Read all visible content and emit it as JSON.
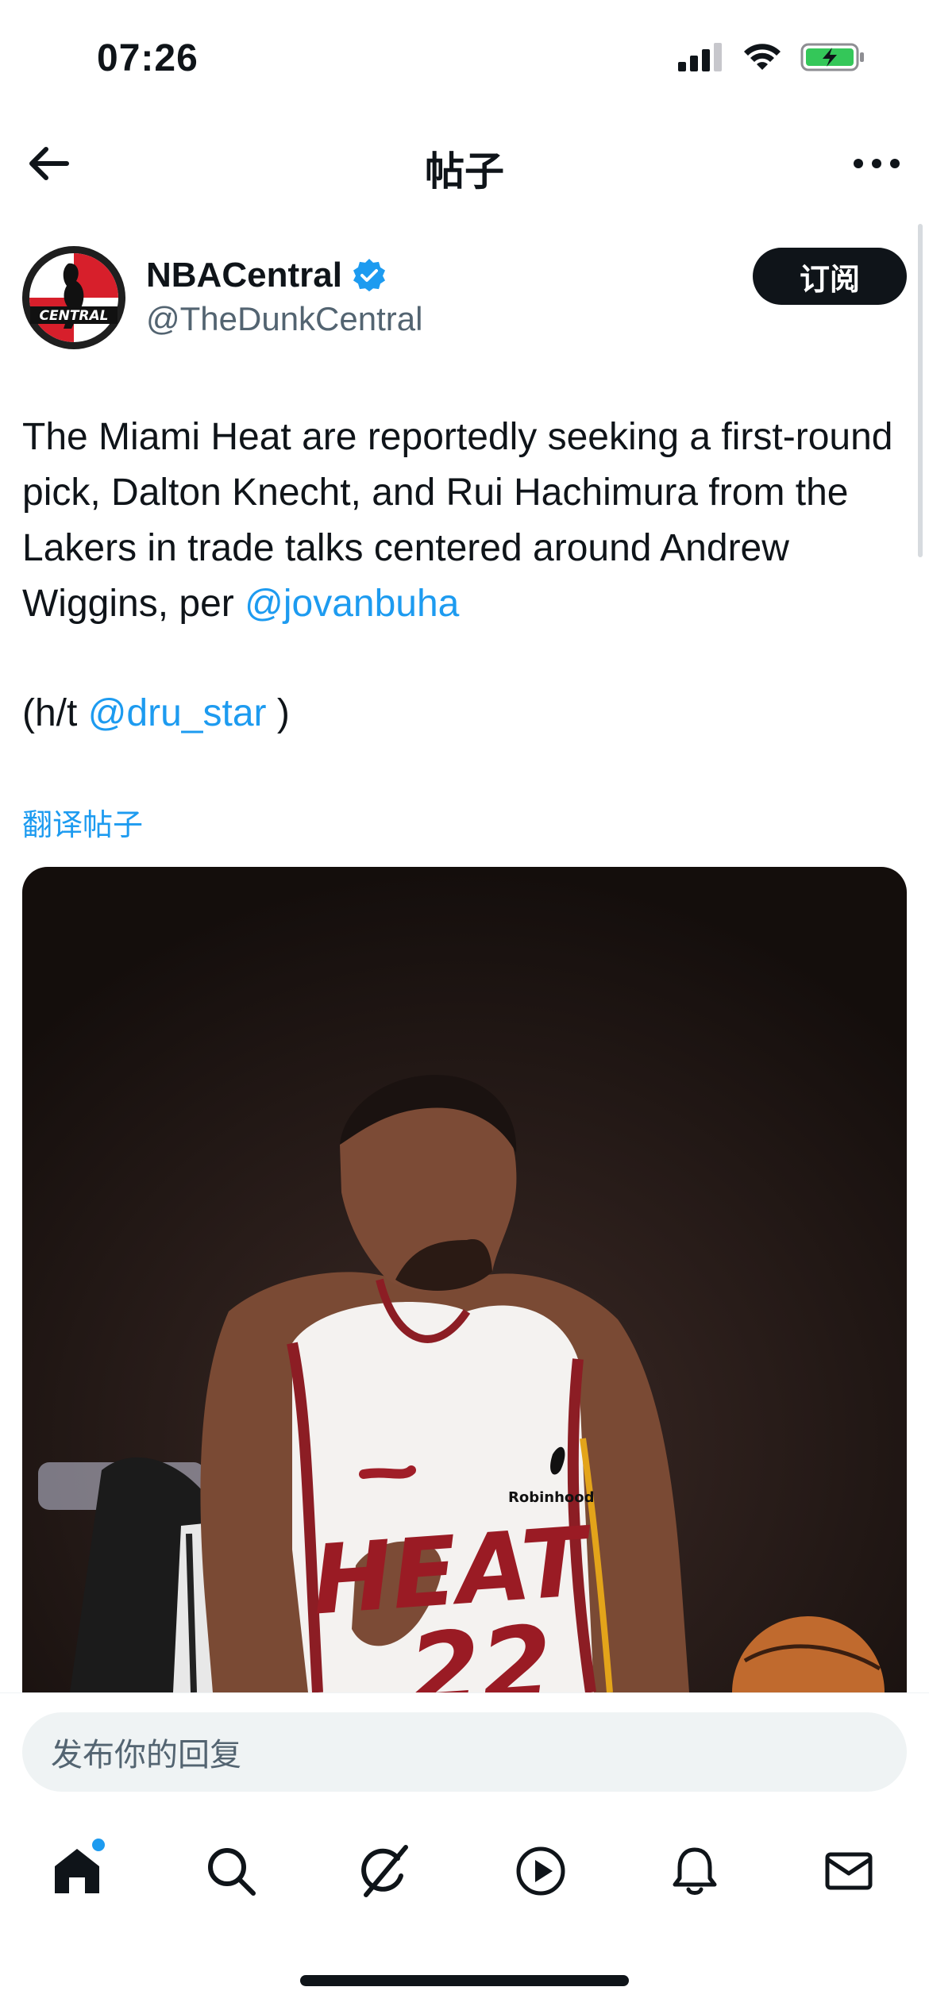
{
  "status": {
    "time": "07:26"
  },
  "nav": {
    "title": "帖子"
  },
  "author": {
    "name": "NBACentral",
    "handle": "@TheDunkCentral",
    "subscribe_label": "订阅",
    "avatar_text": "CENTRAL"
  },
  "post": {
    "text": "The Miami Heat are reportedly seeking a first-round pick, Dalton Knecht, and Rui Hachimura from the Lakers in trade talks centered around Andrew Wiggins, per ",
    "mention1": "@jovanbuha",
    "ht_prefix": "(h/t ",
    "mention2": "@dru_star",
    "ht_suffix": " )",
    "translate_label": "翻译帖子"
  },
  "media": {
    "jersey_sponsor": "Robinhood",
    "jersey_team": "HEAT",
    "jersey_number": "22"
  },
  "reply": {
    "placeholder": "发布你的回复"
  },
  "tabs": [
    {
      "name": "home-icon",
      "active": true
    },
    {
      "name": "search-icon"
    },
    {
      "name": "grok-icon"
    },
    {
      "name": "video-icon"
    },
    {
      "name": "notifications-icon"
    },
    {
      "name": "messages-icon"
    }
  ],
  "colors": {
    "accent": "#1d9bf0",
    "text": "#0f1419",
    "secondary": "#536471",
    "battery": "#34c759"
  }
}
